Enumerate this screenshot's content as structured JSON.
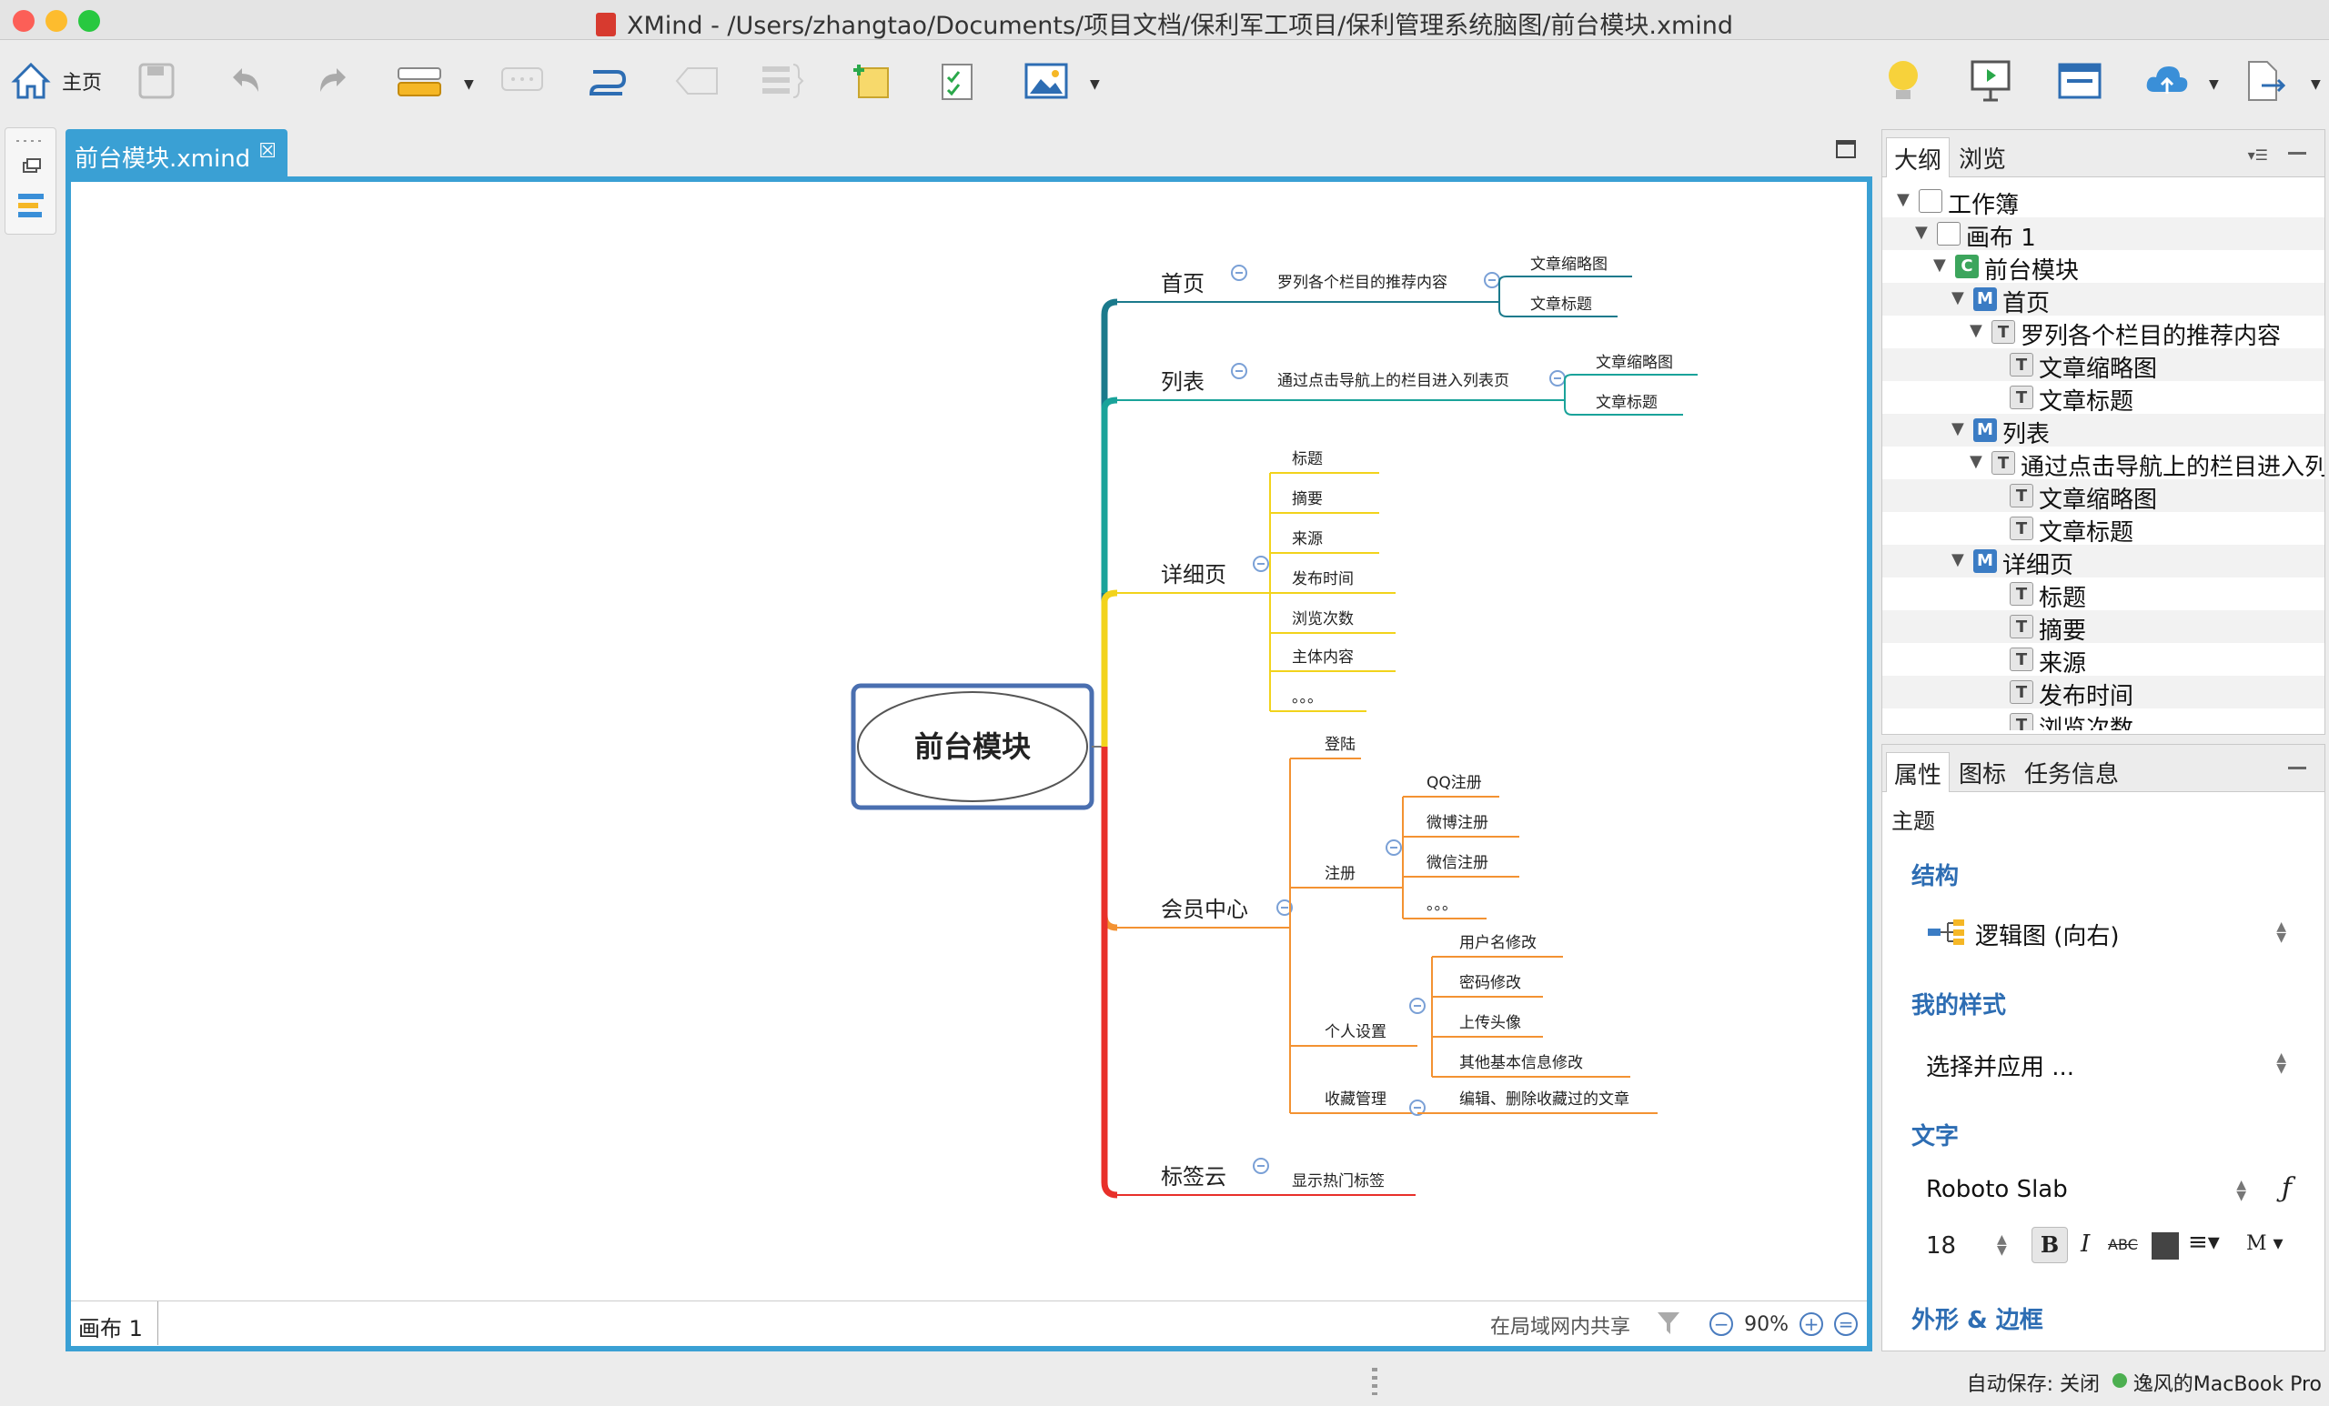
{
  "window": {
    "title": "XMind - /Users/zhangtao/Documents/项目文档/保利军工项目/保利管理系统脑图/前台模块.xmind"
  },
  "toolbar": {
    "home_label": "主页",
    "items": [
      "home-icon",
      "save-icon",
      "undo-icon",
      "redo-icon",
      "structure-icon",
      "callout-icon",
      "relationship-icon",
      "boundary-icon",
      "summary-icon",
      "note-icon",
      "task-icon",
      "image-icon",
      "idea-icon",
      "presentation-icon",
      "layout-icon",
      "share-upload-icon",
      "export-icon"
    ]
  },
  "editor": {
    "tab_title": "前台模块.xmind",
    "sheet_tab": "画布 1",
    "share_text": "在局域网内共享",
    "zoom": "90%"
  },
  "mindmap": {
    "central": "前台模块",
    "branches": [
      {
        "label": "首页",
        "color": "#1b7a8c",
        "children": [
          {
            "label": "罗列各个栏目的推荐内容",
            "children": [
              "文章缩略图",
              "文章标题"
            ]
          }
        ]
      },
      {
        "label": "列表",
        "color": "#1aa39a",
        "children": [
          {
            "label": "通过点击导航上的栏目进入列表页",
            "children": [
              "文章缩略图",
              "文章标题"
            ]
          }
        ]
      },
      {
        "label": "详细页",
        "color": "#f2d31b",
        "children": [
          {
            "label": "标题"
          },
          {
            "label": "摘要"
          },
          {
            "label": "来源"
          },
          {
            "label": "发布时间"
          },
          {
            "label": "浏览次数"
          },
          {
            "label": "主体内容"
          },
          {
            "label": "。。。"
          }
        ]
      },
      {
        "label": "会员中心",
        "color": "#f39232",
        "children": [
          {
            "label": "登陆"
          },
          {
            "label": "注册",
            "children": [
              "QQ注册",
              "微博注册",
              "微信注册",
              "。。。"
            ]
          },
          {
            "label": "个人设置",
            "children": [
              "用户名修改",
              "密码修改",
              "上传头像",
              "其他基本信息修改"
            ]
          },
          {
            "label": "收藏管理",
            "children": [
              "编辑、删除收藏过的文章"
            ]
          }
        ]
      },
      {
        "label": "标签云",
        "color": "#e8302a",
        "children": [
          {
            "label": "显示热门标签"
          }
        ]
      }
    ]
  },
  "outline_panel": {
    "tabs": [
      "大纲",
      "浏览"
    ],
    "rows": [
      {
        "label": "工作簿",
        "type": "wb"
      },
      {
        "label": "画布 1",
        "type": "wb"
      },
      {
        "label": "前台模块",
        "type": "C"
      },
      {
        "label": "首页",
        "type": "M"
      },
      {
        "label": "罗列各个栏目的推荐内容",
        "type": "T"
      },
      {
        "label": "文章缩略图",
        "type": "T"
      },
      {
        "label": "文章标题",
        "type": "T"
      },
      {
        "label": "列表",
        "type": "M"
      },
      {
        "label": "通过点击导航上的栏目进入列表页",
        "type": "T"
      },
      {
        "label": "文章缩略图",
        "type": "T"
      },
      {
        "label": "文章标题",
        "type": "T"
      },
      {
        "label": "详细页",
        "type": "M"
      },
      {
        "label": "标题",
        "type": "T"
      },
      {
        "label": "摘要",
        "type": "T"
      },
      {
        "label": "来源",
        "type": "T"
      },
      {
        "label": "发布时间",
        "type": "T"
      },
      {
        "label": "浏览次数",
        "type": "T"
      }
    ]
  },
  "props_panel": {
    "tabs": [
      "属性",
      "图标",
      "任务信息"
    ],
    "subheader": "主题",
    "structure_title": "结构",
    "structure_value": "逻辑图 (向右)",
    "style_title": "我的样式",
    "style_value": "选择并应用 ...",
    "text_title": "文字",
    "font_name": "Roboto Slab",
    "font_size": "18",
    "shape_title": "外形 & 边框"
  },
  "statusbar": {
    "autosave": "自动保存: 关闭",
    "machine": "逸风的MacBook Pro"
  }
}
